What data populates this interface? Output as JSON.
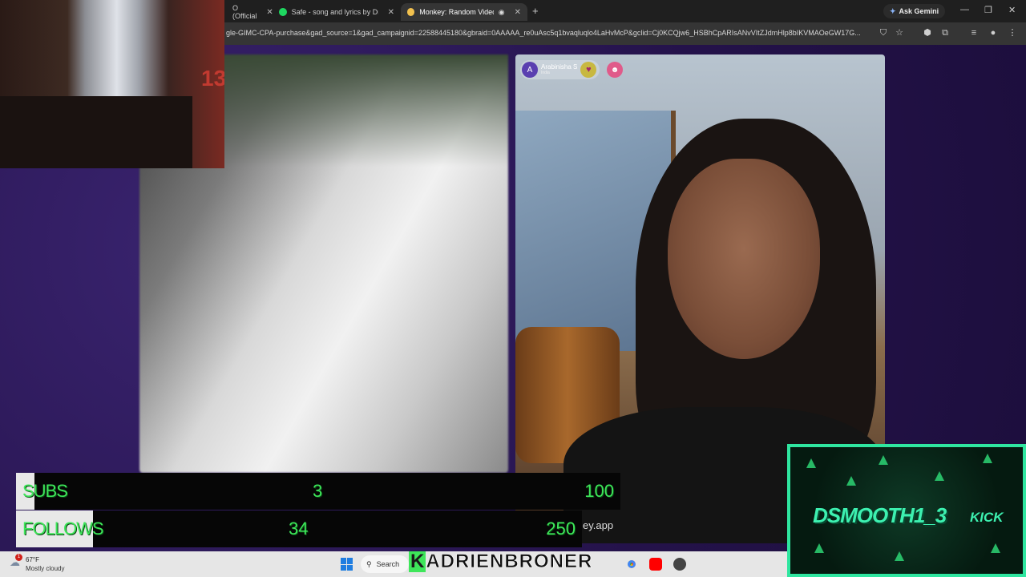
{
  "browser": {
    "tabs": [
      {
        "label": "O (Official",
        "favicon_color": "#ff0000"
      },
      {
        "label": "Safe - song and lyrics by Drü O",
        "favicon_color": "#1ed760"
      },
      {
        "label": "Monkey: Random Video Ch",
        "favicon_color": "#f2c14e",
        "active": true
      }
    ],
    "new_tab": "+",
    "ask_gemini": "Ask Gemini",
    "url": "gle-GIMC-CPA-purchase&gad_source=1&gad_campaignid=22588445180&gbraid=0AAAAA_re0uAsc5q1bvaqluqlo4LaHvMcP&gclid=Cj0KCQjw6_HSBhCpARIsANvVItZJdmHlp8bIKVMAOeGW17G...",
    "window_controls": [
      "—",
      "❐",
      "✕"
    ]
  },
  "video": {
    "partner_name": "Arabinisha S",
    "partner_country": "India",
    "avatar_letter": "A",
    "watermark": "ey.app"
  },
  "goals": {
    "subs": {
      "label": "SUBS",
      "current": "3",
      "target": "100",
      "progress": 0.03
    },
    "follows": {
      "label": "FOLLOWS",
      "current": "34",
      "target": "250",
      "progress": 0.136
    }
  },
  "kick_panel": {
    "name": "DSMOOTH1_3",
    "brand": "KICK"
  },
  "taskbar": {
    "temperature": "67°F",
    "condition": "Mostly cloudy",
    "weather_badge": "1",
    "search_label": "Search"
  },
  "banner": {
    "first_letter": "K",
    "rest": "ADRIENBRONER"
  },
  "webcam": {
    "wall_number": "13"
  }
}
